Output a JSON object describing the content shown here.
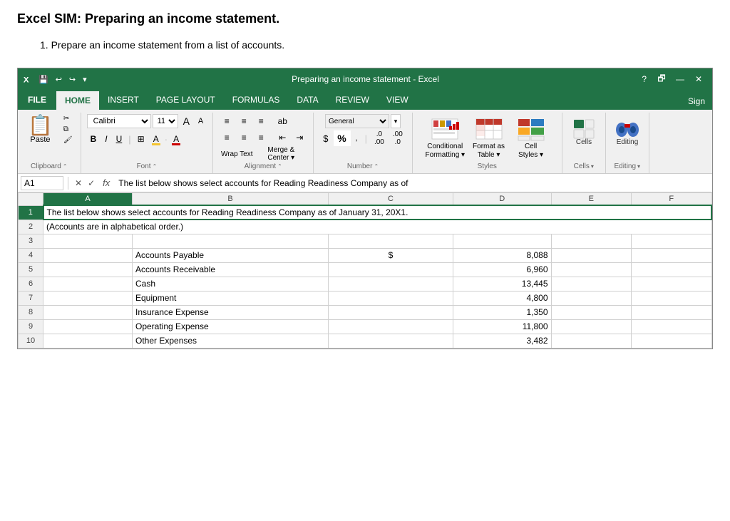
{
  "page": {
    "title": "Excel SIM: Preparing an income statement.",
    "instruction": "1. Prepare an income statement from a list of accounts."
  },
  "titlebar": {
    "app_title": "Preparing an income statement - Excel",
    "help": "?",
    "restore": "🗗",
    "minimize": "—",
    "close": "✕"
  },
  "quickaccess": {
    "save": "💾",
    "undo": "↩",
    "undo_arrow": "↪",
    "more": "▾"
  },
  "tabs": [
    {
      "id": "file",
      "label": "FILE",
      "active": false,
      "file": true
    },
    {
      "id": "home",
      "label": "HOME",
      "active": true
    },
    {
      "id": "insert",
      "label": "INSERT",
      "active": false
    },
    {
      "id": "pagelayout",
      "label": "PAGE LAYOUT",
      "active": false
    },
    {
      "id": "formulas",
      "label": "FORMULAS",
      "active": false
    },
    {
      "id": "data",
      "label": "DATA",
      "active": false
    },
    {
      "id": "review",
      "label": "REVIEW",
      "active": false
    },
    {
      "id": "view",
      "label": "VIEW",
      "active": false
    }
  ],
  "ribbon": {
    "groups": {
      "clipboard": {
        "label": "Clipboard",
        "paste": "Paste"
      },
      "font": {
        "label": "Font",
        "name": "Calibri",
        "size": "11"
      },
      "alignment": {
        "label": "Alignment"
      },
      "number": {
        "label": "Number",
        "symbol": "%"
      },
      "styles": {
        "label": "Styles",
        "conditional_formatting": "Conditional\nFormatting",
        "format_as_table": "Format as\nTable",
        "cell_styles": "Cell\nStyles"
      },
      "cells": {
        "label": "Cells",
        "button": "Cells"
      },
      "editing": {
        "label": "Editing",
        "button": "Editing"
      }
    }
  },
  "formulabar": {
    "cell_ref": "A1",
    "formula": "The list below shows select accounts for Reading Readiness Company as of"
  },
  "spreadsheet": {
    "columns": [
      "A",
      "B",
      "C",
      "D",
      "E",
      "F"
    ],
    "rows": [
      {
        "num": "1",
        "cells": [
          {
            "col": "A",
            "value": "The list below shows select accounts for Reading Readiness Company as of January 31, 20X1.",
            "span": 6,
            "selected": true
          }
        ]
      },
      {
        "num": "2",
        "cells": [
          {
            "col": "A",
            "value": "(Accounts are in alphabetical order.)",
            "span": 6
          }
        ]
      },
      {
        "num": "3",
        "cells": [
          {
            "col": "A",
            "value": ""
          },
          {
            "col": "B",
            "value": ""
          },
          {
            "col": "C",
            "value": ""
          },
          {
            "col": "D",
            "value": ""
          },
          {
            "col": "E",
            "value": ""
          },
          {
            "col": "F",
            "value": ""
          }
        ]
      },
      {
        "num": "4",
        "cells": [
          {
            "col": "A",
            "value": ""
          },
          {
            "col": "B",
            "value": "Accounts Payable"
          },
          {
            "col": "C",
            "value": "$",
            "align": "center"
          },
          {
            "col": "D",
            "value": "8,088",
            "align": "right"
          },
          {
            "col": "E",
            "value": ""
          },
          {
            "col": "F",
            "value": ""
          }
        ]
      },
      {
        "num": "5",
        "cells": [
          {
            "col": "A",
            "value": ""
          },
          {
            "col": "B",
            "value": "Accounts Receivable"
          },
          {
            "col": "C",
            "value": ""
          },
          {
            "col": "D",
            "value": "6,960",
            "align": "right"
          },
          {
            "col": "E",
            "value": ""
          },
          {
            "col": "F",
            "value": ""
          }
        ]
      },
      {
        "num": "6",
        "cells": [
          {
            "col": "A",
            "value": ""
          },
          {
            "col": "B",
            "value": "Cash"
          },
          {
            "col": "C",
            "value": ""
          },
          {
            "col": "D",
            "value": "13,445",
            "align": "right"
          },
          {
            "col": "E",
            "value": ""
          },
          {
            "col": "F",
            "value": ""
          }
        ]
      },
      {
        "num": "7",
        "cells": [
          {
            "col": "A",
            "value": ""
          },
          {
            "col": "B",
            "value": "Equipment"
          },
          {
            "col": "C",
            "value": ""
          },
          {
            "col": "D",
            "value": "4,800",
            "align": "right"
          },
          {
            "col": "E",
            "value": ""
          },
          {
            "col": "F",
            "value": ""
          }
        ]
      },
      {
        "num": "8",
        "cells": [
          {
            "col": "A",
            "value": ""
          },
          {
            "col": "B",
            "value": "Insurance Expense"
          },
          {
            "col": "C",
            "value": ""
          },
          {
            "col": "D",
            "value": "1,350",
            "align": "right"
          },
          {
            "col": "E",
            "value": ""
          },
          {
            "col": "F",
            "value": ""
          }
        ]
      },
      {
        "num": "9",
        "cells": [
          {
            "col": "A",
            "value": ""
          },
          {
            "col": "B",
            "value": "Operating Expense"
          },
          {
            "col": "C",
            "value": ""
          },
          {
            "col": "D",
            "value": "11,800",
            "align": "right"
          },
          {
            "col": "E",
            "value": ""
          },
          {
            "col": "F",
            "value": ""
          }
        ]
      },
      {
        "num": "10",
        "cells": [
          {
            "col": "A",
            "value": ""
          },
          {
            "col": "B",
            "value": "Other Expenses"
          },
          {
            "col": "C",
            "value": ""
          },
          {
            "col": "D",
            "value": "3,482",
            "align": "right"
          },
          {
            "col": "E",
            "value": ""
          },
          {
            "col": "F",
            "value": ""
          }
        ]
      }
    ]
  }
}
